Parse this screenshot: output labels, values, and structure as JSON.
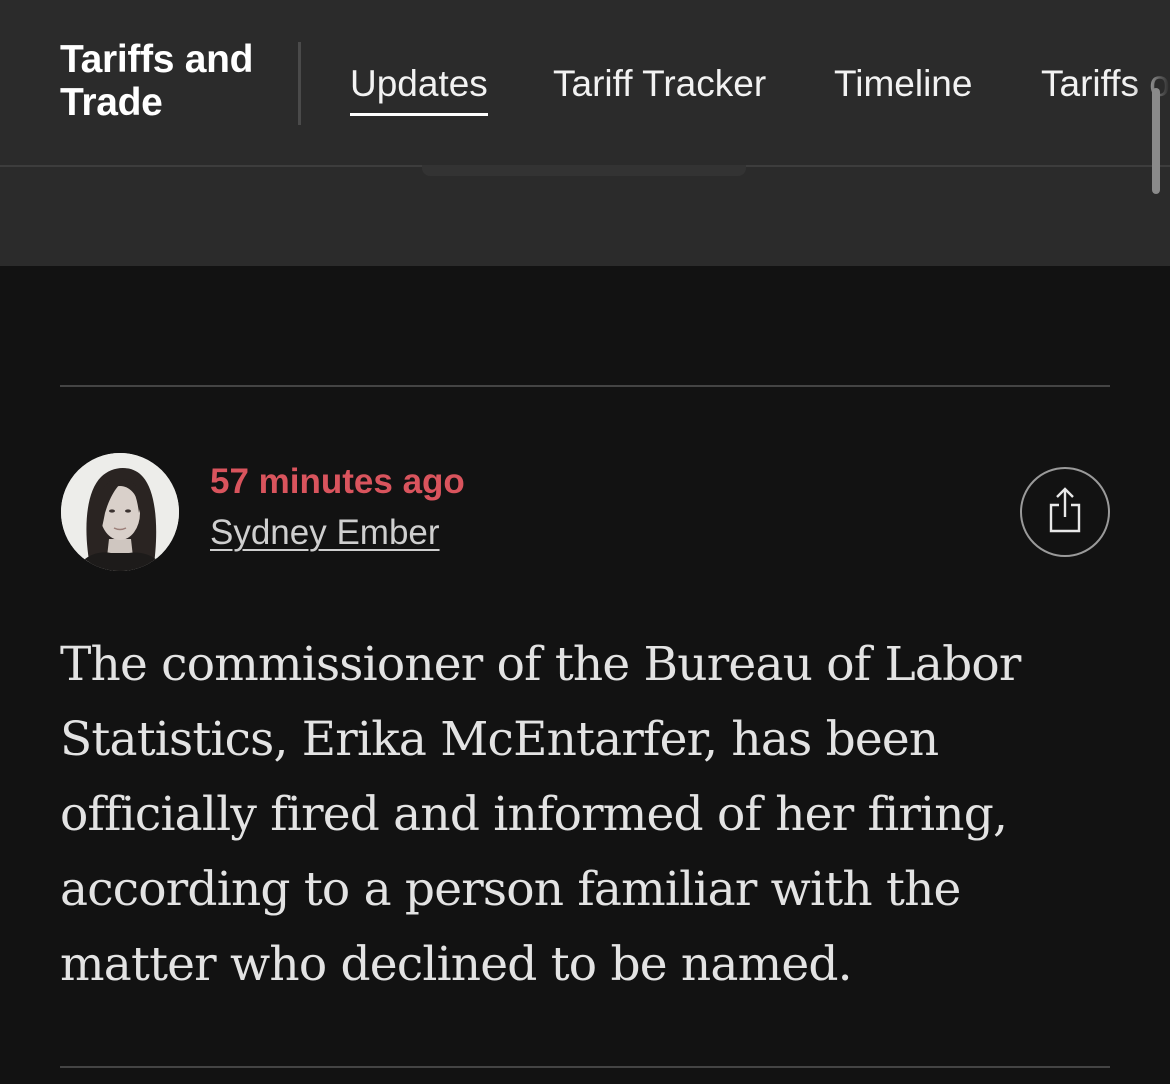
{
  "header": {
    "brand": "Tariffs and Trade",
    "tabs": [
      {
        "label": "Updates",
        "active": true
      },
      {
        "label": "Tariff Tracker",
        "active": false
      },
      {
        "label": "Timeline",
        "active": false
      },
      {
        "label": "Tariffs on",
        "active": false
      }
    ]
  },
  "post": {
    "timestamp": "57 minutes ago",
    "author": "Sydney Ember",
    "share_icon": "share-icon",
    "body": "The commissioner of the Bureau of Labor Statistics, Erika McEntarfer, has been officially fired and informed of her firing, according to a person familiar with the matter who declined to be named."
  },
  "colors": {
    "background": "#121212",
    "header_background": "#2b2b2b",
    "timestamp": "#d9545d",
    "text": "#e3e3e3"
  }
}
